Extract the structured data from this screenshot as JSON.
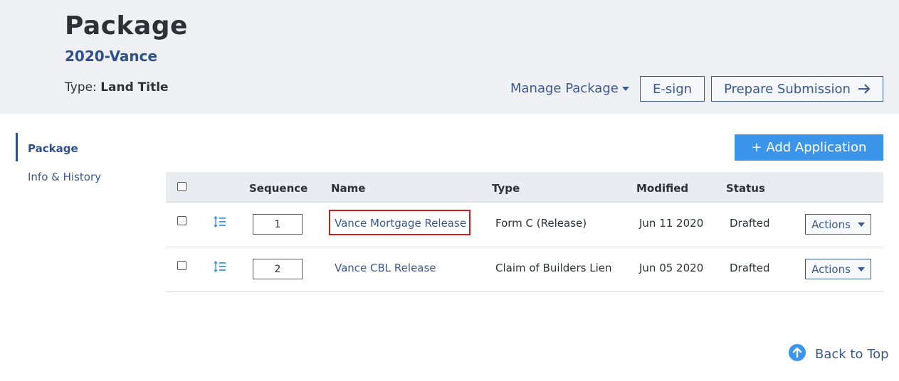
{
  "header": {
    "title": "Package",
    "package_id": "2020-Vance",
    "type_label": "Type:",
    "type_value": "Land Title",
    "manage_label": "Manage Package",
    "esign_label": "E-sign",
    "prepare_label": "Prepare Submission"
  },
  "sidenav": {
    "items": [
      {
        "label": "Package",
        "active": true
      },
      {
        "label": "Info & History",
        "active": false
      }
    ]
  },
  "toolbar": {
    "add_label": "+ Add Application"
  },
  "table": {
    "columns": [
      "Sequence",
      "Name",
      "Type",
      "Modified",
      "Status"
    ],
    "rows": [
      {
        "sequence": "1",
        "name": "Vance Mortgage Release",
        "type": "Form C (Release)",
        "modified": "Jun 11 2020",
        "status": "Drafted",
        "actions_label": "Actions"
      },
      {
        "sequence": "2",
        "name": "Vance CBL Release",
        "type": "Claim of Builders Lien",
        "modified": "Jun 05 2020",
        "status": "Drafted",
        "actions_label": "Actions"
      }
    ]
  },
  "footer": {
    "back_to_top": "Back to Top"
  },
  "colors": {
    "primary": "#3a5a91",
    "accent_button": "#3b95e8",
    "header_bg": "#eef0f3",
    "highlight": "#d11a1a"
  },
  "icons": [
    "caret-down-icon",
    "arrow-right-icon",
    "reorder-icon",
    "arrow-up-circle-icon"
  ]
}
